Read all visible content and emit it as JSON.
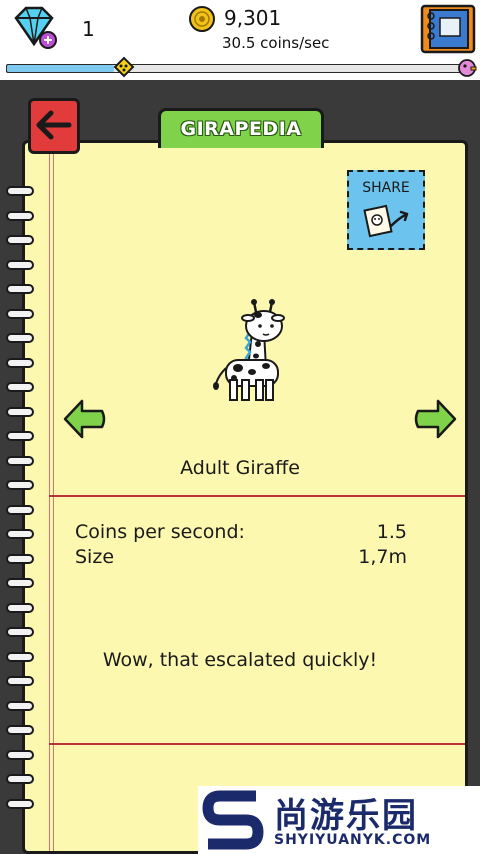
{
  "header": {
    "gem_count": "1",
    "coin_total": "9,301",
    "coin_rate": "30.5 coins/sec",
    "progress_fraction": 0.23
  },
  "tab": {
    "label": "GIRAPEDIA"
  },
  "share": {
    "label": "SHARE"
  },
  "creature": {
    "name": "Adult Giraffe",
    "stats": [
      {
        "label": "Coins per second:",
        "value": "1.5"
      },
      {
        "label": "Size",
        "value": "1,7m"
      }
    ],
    "quote": "Wow, that escalated quickly!"
  },
  "watermark": {
    "cn": "尚游乐园",
    "en": "SHYIYUANYK.COM"
  },
  "colors": {
    "page": "#fcf8b0",
    "tab": "#7fd24a",
    "back": "#e23b3b",
    "share": "#6cc4ee",
    "arrow": "#7fd24a",
    "progress": "#7ec9f0"
  },
  "icons": {
    "gem": "gem-plus-icon",
    "coin": "coin-icon",
    "book": "giraffe-book-icon",
    "back": "back-arrow-icon",
    "prev": "left-arrow-icon",
    "next": "right-arrow-icon",
    "share": "share-icon"
  }
}
